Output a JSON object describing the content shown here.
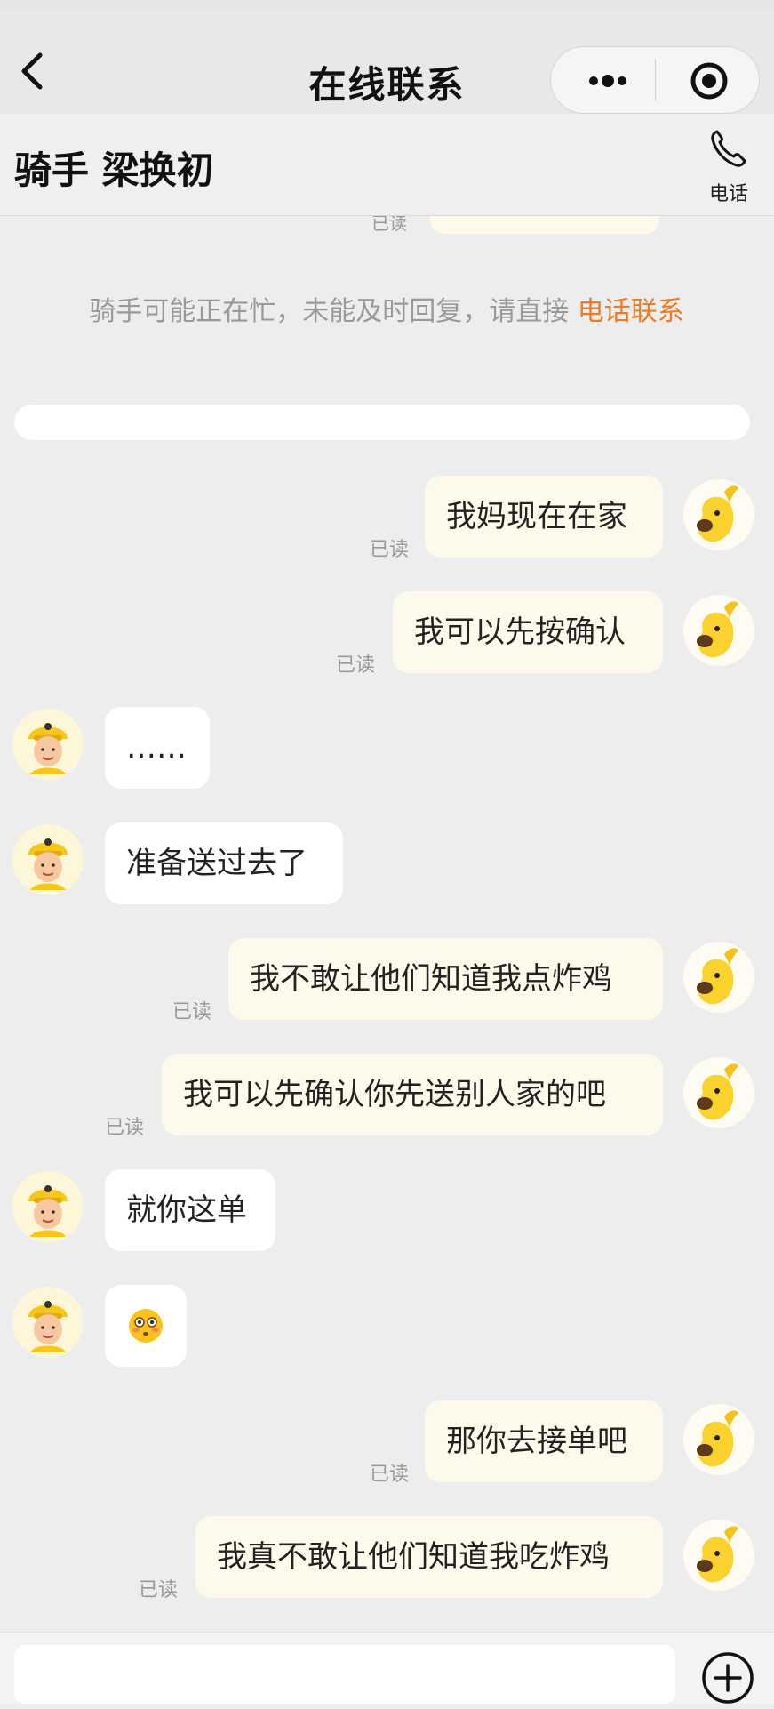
{
  "nav": {
    "title": "在线联系"
  },
  "header": {
    "rider_name": "骑手 梁换初",
    "phone_label": "电话"
  },
  "notice": {
    "text": "骑手可能正在忙，未能及时回复，请直接 ",
    "link": "电话联系"
  },
  "partial_top": {
    "read": "已读"
  },
  "messages": [
    {
      "from": "me",
      "text": "我妈现在在家",
      "status": "已读"
    },
    {
      "from": "me",
      "text": "我可以先按确认",
      "status": "已读"
    },
    {
      "from": "rider",
      "text": "……"
    },
    {
      "from": "rider",
      "text": "准备送过去了"
    },
    {
      "from": "me",
      "text": "我不敢让他们知道我点炸鸡",
      "status": "已读"
    },
    {
      "from": "me",
      "text": "我可以先确认你先送别人家的吧",
      "status": "已读"
    },
    {
      "from": "rider",
      "text": "就你这单"
    },
    {
      "from": "rider",
      "emoji": "😳"
    },
    {
      "from": "me",
      "text": "那你去接单吧",
      "status": "已读"
    },
    {
      "from": "me",
      "text": "我真不敢让他们知道我吃炸鸡",
      "status": "已读"
    }
  ],
  "icons": {
    "back": "chevron-left-icon",
    "more": "more-dots-icon",
    "close": "target-icon",
    "phone": "phone-icon",
    "plus": "plus-circle-icon",
    "my_avatar": "yellow-dog-avatar-icon",
    "rider_avatar": "rider-helmet-avatar-icon"
  },
  "colors": {
    "accent": "#f07a22",
    "my_bubble": "#fefaeb",
    "rider_bubble": "#ffffff",
    "background": "#ededed"
  }
}
